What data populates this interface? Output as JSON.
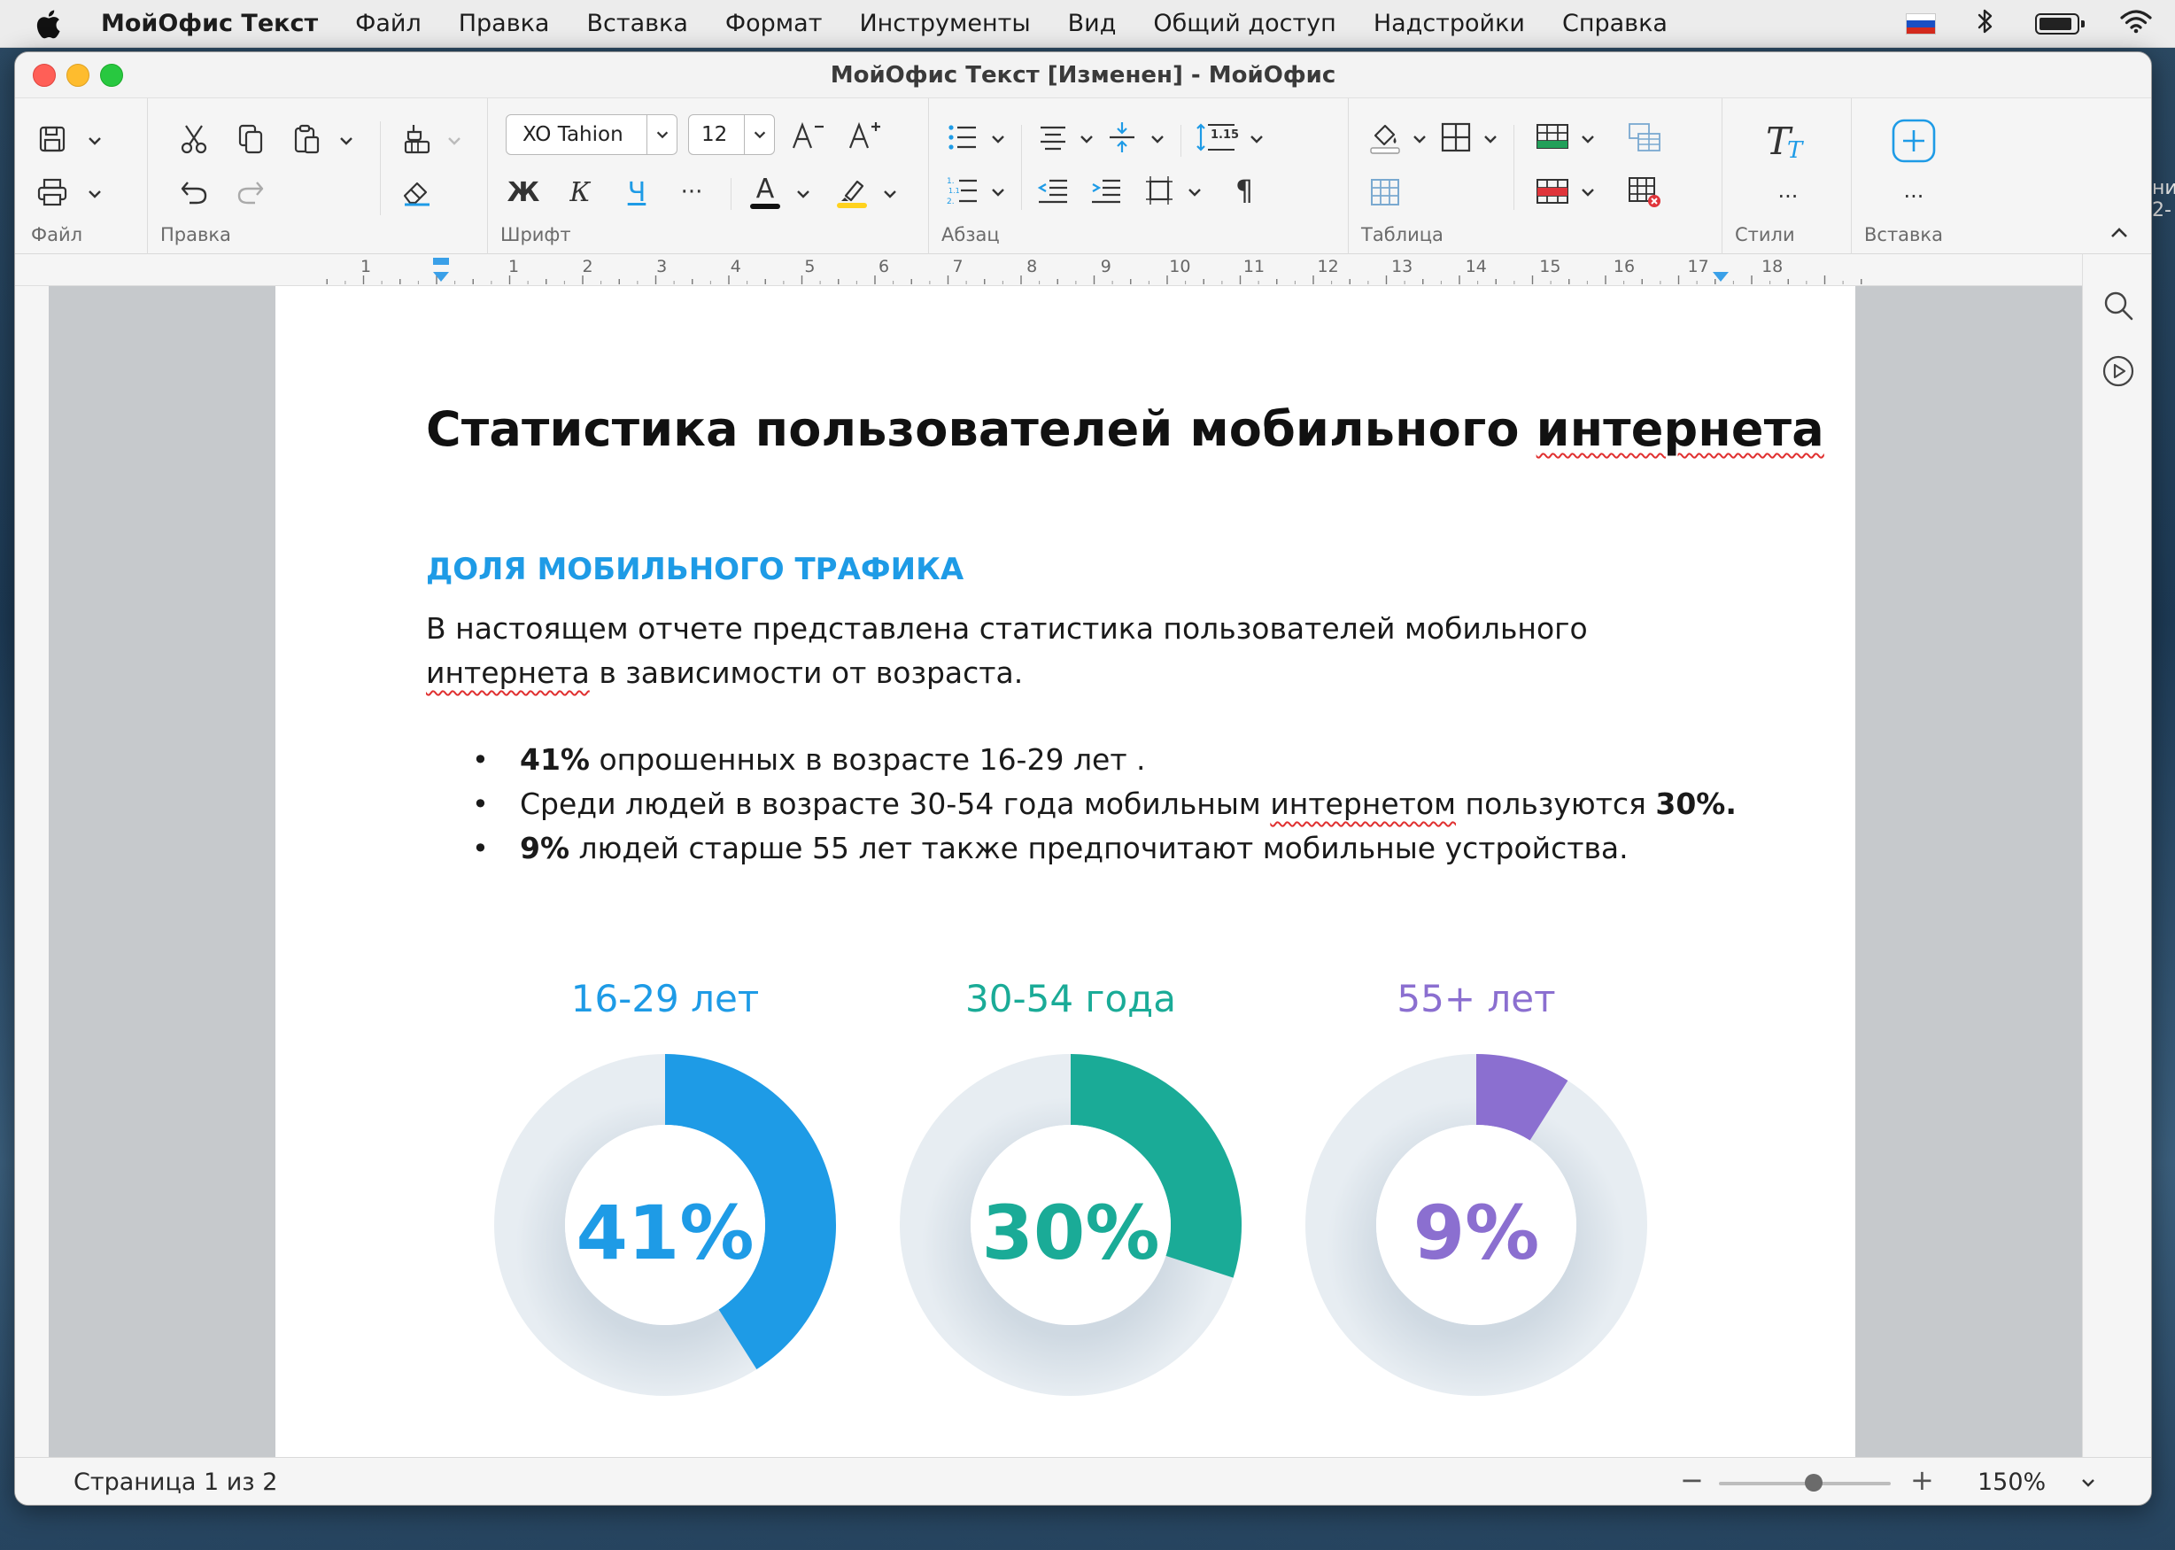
{
  "menubar": {
    "app_name": "МойОфис Текст",
    "items": [
      "Файл",
      "Правка",
      "Вставка",
      "Формат",
      "Инструменты",
      "Вид",
      "Общий доступ",
      "Надстройки",
      "Справка"
    ]
  },
  "window": {
    "title": "МойОфис Текст [Изменен] - МойОфис"
  },
  "ribbon": {
    "groups": {
      "file": "Файл",
      "edit": "Правка",
      "font": "Шрифт",
      "paragraph": "Абзац",
      "table": "Таблица",
      "styles": "Стили",
      "insert": "Вставка"
    },
    "font_name": "XO Tahion",
    "font_size": "12",
    "bold_glyph": "Ж",
    "italic_glyph": "К",
    "underline_glyph": "Ч",
    "more_glyph": "···",
    "font_color_glyph": "A",
    "pilcrow_glyph": "¶",
    "line_spacing_value": "1.15",
    "font_color": "#111111",
    "highlight_color": "#ffd21e"
  },
  "ruler": {
    "numbers_left": [
      "1"
    ],
    "numbers": [
      "1",
      "2",
      "3",
      "4",
      "5",
      "6",
      "7",
      "8",
      "9",
      "10",
      "11",
      "12",
      "13",
      "14",
      "15",
      "16",
      "17",
      "18"
    ]
  },
  "document": {
    "title_plain": "Статистика пользователей мобильного ",
    "title_misspelled": "интернета",
    "subheading": "ДОЛЯ МОБИЛЬНОГО ТРАФИКА",
    "para_part1": "В настоящем отчете представлена статистика пользователей мобильного ",
    "para_misspelled": "интернета",
    "para_part2": " в зависимости от возраста.",
    "bullets": [
      {
        "bold_start": "41%",
        "text": " опрошенных в возрасте 16-29 лет ."
      },
      {
        "text_start": "Среди людей в возрасте 30-54 года мобильным ",
        "misspelled": "интернетом",
        "text_mid": " пользуются ",
        "bold_end": "30%."
      },
      {
        "bold_start": "9%",
        "text": " людей старше 55 лет также предпочитают мобильные устройства."
      }
    ]
  },
  "chart_data": {
    "type": "pie",
    "variant": "donut",
    "categories": [
      "16-29 лет",
      "30-54 года",
      "55+ лет"
    ],
    "values": [
      41,
      30,
      9
    ],
    "labels": [
      "41%",
      "30%",
      "9%"
    ],
    "colors": [
      "#1e9be6",
      "#1aab97",
      "#8b6fd0"
    ],
    "track_color": "#e7edf2"
  },
  "statusbar": {
    "page_info": "Страница 1 из 2",
    "zoom_minus": "−",
    "zoom_plus": "+",
    "zoom": "150%",
    "zoom_level_fraction": 0.55
  },
  "colors": {
    "accent_blue": "#1e9be6",
    "spellcheck_red": "#e03030",
    "ruler_marker": "#3aa0e8"
  },
  "icons": {
    "save": "save-icon",
    "print": "print-icon",
    "cut": "scissors-icon",
    "copy": "copy-icon",
    "paste": "paste-icon",
    "undo": "undo-icon",
    "redo": "redo-icon",
    "format_painter": "format-painter-icon",
    "clear_format": "eraser-icon",
    "search": "search-icon",
    "presentation": "play-icon"
  }
}
